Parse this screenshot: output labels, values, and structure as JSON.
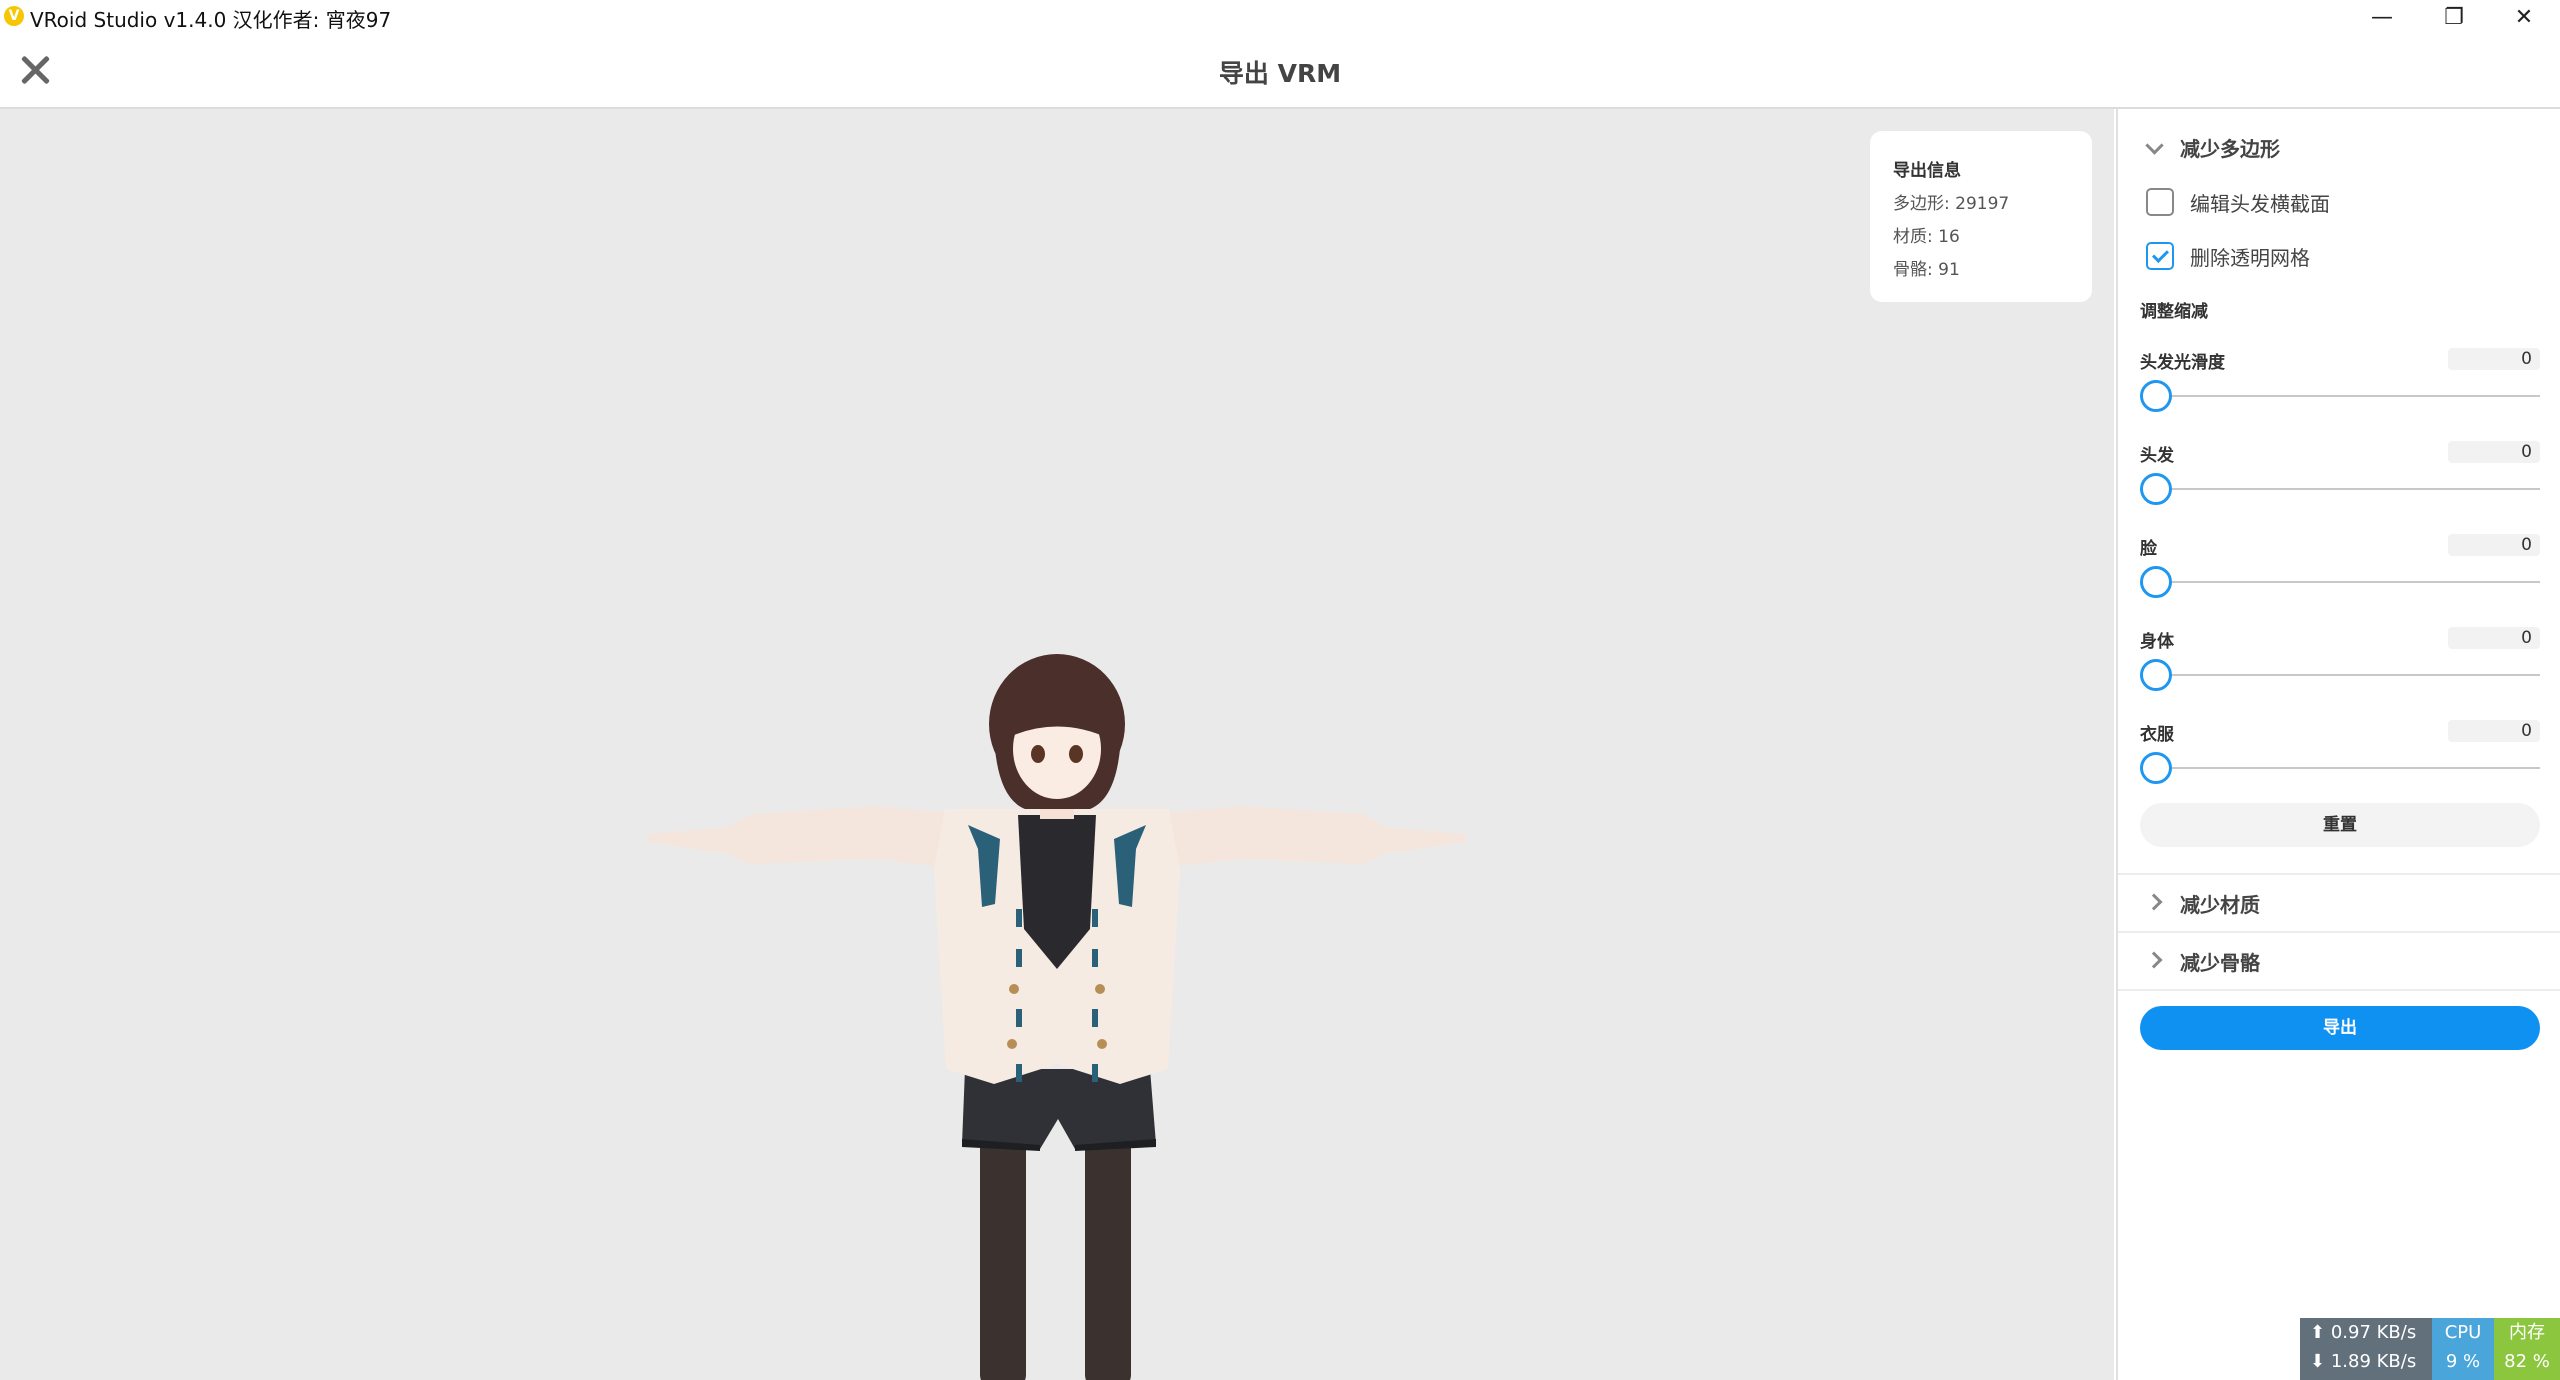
{
  "window": {
    "title": "VRoid Studio v1.4.0 汉化作者: 宵夜97",
    "minimize_icon": "—",
    "maximize_icon": "❐",
    "close_icon": "✕"
  },
  "header": {
    "title": "导出 VRM"
  },
  "export_info": {
    "title": "导出信息",
    "polygons": "多边形: 29197",
    "materials": "材质: 16",
    "bones": "骨骼: 91"
  },
  "panel": {
    "reduce_polygons": {
      "title": "减少多边形",
      "expanded": true,
      "options": [
        {
          "label": "编辑头发横截面",
          "checked": false
        },
        {
          "label": "删除透明网格",
          "checked": true
        }
      ],
      "adjust_title": "调整缩减",
      "sliders": [
        {
          "label": "头发光滑度",
          "value": "0"
        },
        {
          "label": "头发",
          "value": "0"
        },
        {
          "label": "脸",
          "value": "0"
        },
        {
          "label": "身体",
          "value": "0"
        },
        {
          "label": "衣服",
          "value": "0"
        }
      ],
      "reset_label": "重置"
    },
    "reduce_materials": {
      "title": "减少材质",
      "expanded": false
    },
    "reduce_bones": {
      "title": "减少骨骼",
      "expanded": false
    },
    "export_label": "导出",
    "accent_color": "#0f91f2"
  },
  "netmon": {
    "upload": "0.97 KB/s",
    "download": "1.89 KB/s",
    "up_arrow": "⬆",
    "down_arrow": "⬇",
    "cpu_label": "CPU",
    "cpu_value": "9 %",
    "mem_label": "内存",
    "mem_value": "82 %"
  }
}
